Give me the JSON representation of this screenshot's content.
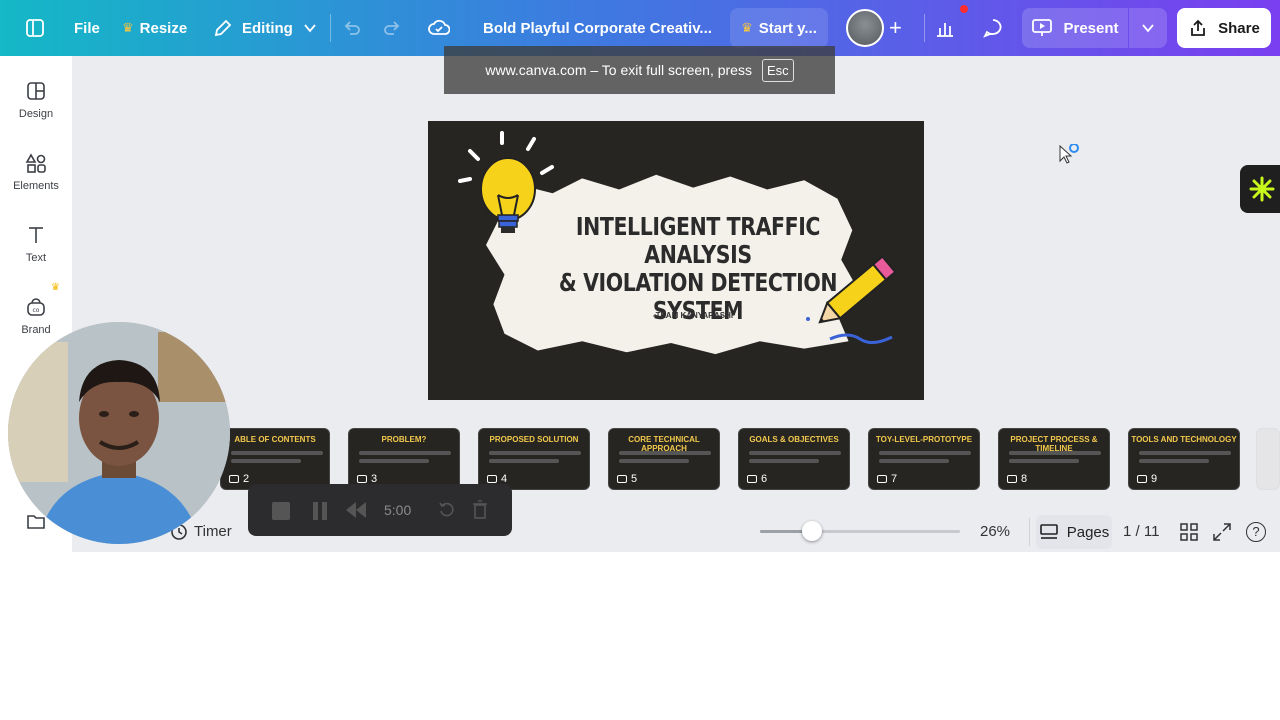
{
  "topbar": {
    "file_label": "File",
    "resize_label": "Resize",
    "editing_label": "Editing",
    "doc_title": "Bold Playful Corporate Creativ...",
    "start_label": "Start y...",
    "present_label": "Present",
    "share_label": "Share"
  },
  "banner": {
    "text": "www.canva.com – To exit full screen, press",
    "key": "Esc"
  },
  "sidebar": {
    "items": [
      {
        "label": "Design",
        "icon": "design-icon"
      },
      {
        "label": "Elements",
        "icon": "elements-icon"
      },
      {
        "label": "Text",
        "icon": "text-icon"
      },
      {
        "label": "Brand",
        "icon": "brand-icon"
      }
    ]
  },
  "slide": {
    "title_lines": [
      "INTELLIGENT TRAFFIC ANALYSIS",
      "& VIOLATION DETECTION",
      "SYSTEM"
    ],
    "subtitle": "-TEAM KANYARASHI"
  },
  "thumbnails": [
    {
      "num": "2",
      "title": "ABLE OF CONTENTS"
    },
    {
      "num": "3",
      "title": "PROBLEM?"
    },
    {
      "num": "4",
      "title": "PROPOSED SOLUTION"
    },
    {
      "num": "5",
      "title": "CORE TECHNICAL APPROACH"
    },
    {
      "num": "6",
      "title": "GOALS & OBJECTIVES"
    },
    {
      "num": "7",
      "title": "TOY-LEVEL-PROTOTYPE"
    },
    {
      "num": "8",
      "title": "PROJECT PROCESS & TIMELINE"
    },
    {
      "num": "9",
      "title": "TOOLS AND TECHNOLOGY"
    }
  ],
  "timer": {
    "label": "Timer",
    "time": "5:00"
  },
  "zoom": {
    "percent_label": "26%",
    "level": 0.26
  },
  "pages": {
    "label": "Pages",
    "counter": "1 / 11"
  },
  "colors": {
    "accent_gradient_start": "#14b8c6",
    "accent_gradient_end": "#7a3ff0",
    "slide_bg": "#272522",
    "thumb_title": "#f2c94c"
  }
}
